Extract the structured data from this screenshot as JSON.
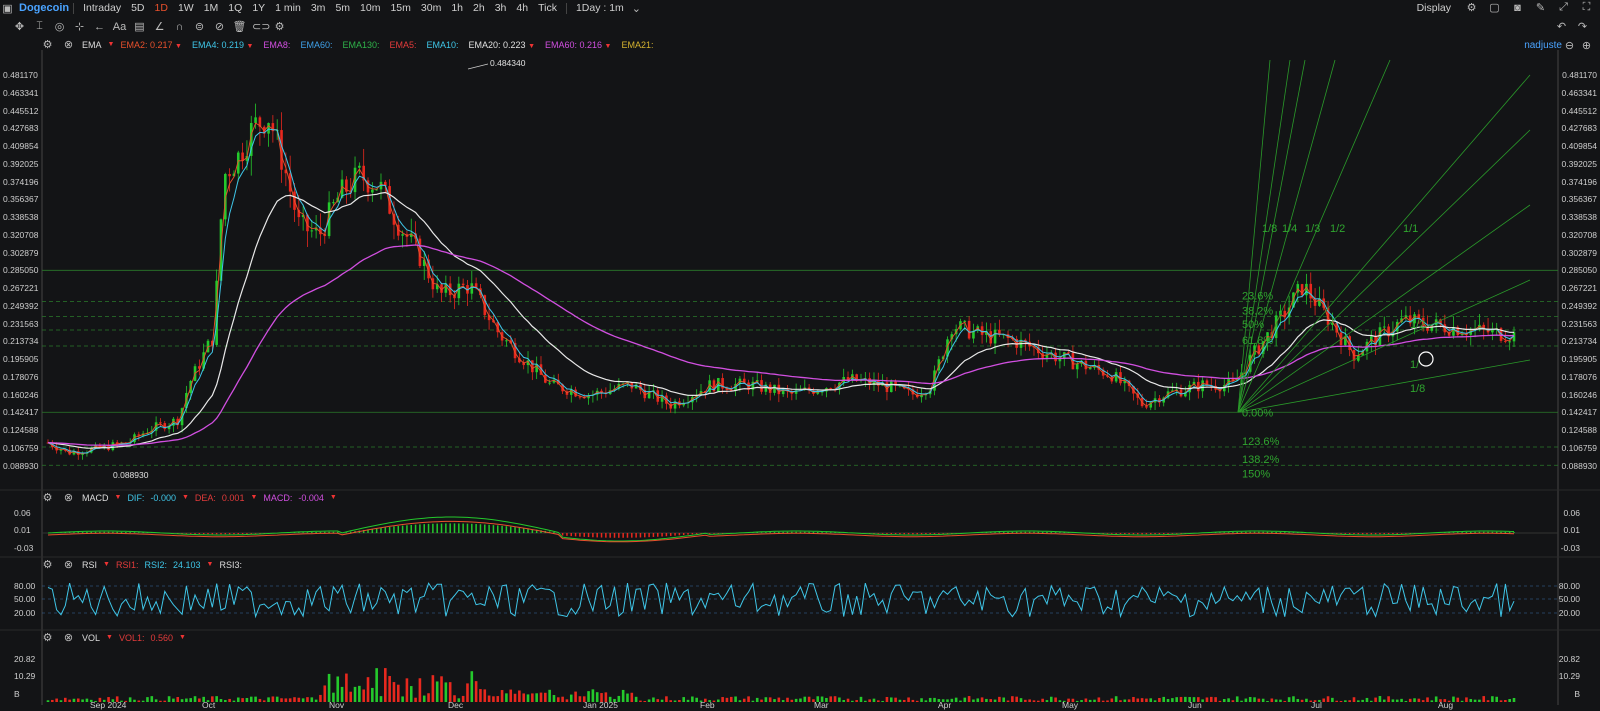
{
  "topbar": {
    "symbol": "Dogecoin",
    "timeframes": [
      "Intraday",
      "5D",
      "1D",
      "1W",
      "1M",
      "1Q",
      "1Y",
      "1 min",
      "3m",
      "5m",
      "10m",
      "15m",
      "30m",
      "1h",
      "2h",
      "3h",
      "4h",
      "Tick"
    ],
    "active_timeframe": "1D",
    "interval": "1Day : 1m",
    "display": "Display"
  },
  "toolbar": {
    "icons": [
      "move-icon",
      "cursor-icon",
      "circle-tool-icon",
      "measure-icon",
      "undo-arrow-icon",
      "text-icon",
      "comment-icon",
      "line-icon",
      "magnet-icon",
      "eye-icon",
      "hide-icon",
      "trash-icon",
      "link-icon",
      "settings-icon"
    ]
  },
  "ema": {
    "label": "EMA",
    "items": [
      {
        "name": "EMA2:",
        "value": "0.217",
        "color": "#e8502c"
      },
      {
        "name": "EMA4:",
        "value": "0.219",
        "color": "#3fc6e8"
      },
      {
        "name": "EMA8:",
        "value": "",
        "color": "#d14fe0"
      },
      {
        "name": "EMA60:",
        "value": "",
        "color": "#3fa0e8"
      },
      {
        "name": "EMA130:",
        "value": "",
        "color": "#2fb34a"
      },
      {
        "name": "EMA5:",
        "value": "",
        "color": "#e33b3b"
      },
      {
        "name": "EMA10:",
        "value": "",
        "color": "#3fc6e8"
      },
      {
        "name": "EMA20:",
        "value": "0.223",
        "color": "#e0e0e0"
      },
      {
        "name": "EMA60:",
        "value": "0.216",
        "color": "#d14fe0"
      },
      {
        "name": "EMA21:",
        "value": "",
        "color": "#d4b22f"
      }
    ],
    "adjust": "nadjuste"
  },
  "price_axis": [
    "0.481170",
    "0.463341",
    "0.445512",
    "0.427683",
    "0.409854",
    "0.392025",
    "0.374196",
    "0.356367",
    "0.338538",
    "0.320708",
    "0.302879",
    "0.285050",
    "0.267221",
    "0.249392",
    "0.231563",
    "0.213734",
    "0.195905",
    "0.178076",
    "0.160246",
    "0.142417",
    "0.124588",
    "0.106759",
    "0.088930"
  ],
  "annotations": {
    "high": "0.484340",
    "low": "0.088930"
  },
  "fib": {
    "levels": [
      "23.6%",
      "38.2%",
      "50%",
      "61.8%",
      "0.00%",
      "123.6%",
      "138.2%",
      "150%"
    ],
    "fan": [
      "1/8",
      "1/4",
      "1/3",
      "1/2",
      "1/1",
      "1/2",
      "1/",
      "1/8"
    ]
  },
  "macd": {
    "label": "MACD",
    "dif": "DIF:",
    "dif_val": "-0.000",
    "dea": "DEA:",
    "dea_val": "0.001",
    "macd": "MACD:",
    "macd_val": "-0.004",
    "axis": [
      "0.06",
      "0.01",
      "-0.03"
    ]
  },
  "rsi": {
    "label": "RSI",
    "rsi1": "RSI1:",
    "rsi2": "RSI2:",
    "rsi2_val": "24.103",
    "rsi3": "RSI3:",
    "axis": [
      "80.00",
      "50.00",
      "20.00"
    ]
  },
  "vol": {
    "label": "VOL",
    "vol1": "VOL1:",
    "vol1_val": "0.560",
    "axis": [
      "20.82",
      "10.29",
      "B"
    ]
  },
  "time_axis": [
    "Sep 2024",
    "Oct",
    "Nov",
    "Dec",
    "Jan 2025",
    "Feb",
    "Mar",
    "Apr",
    "May",
    "Jun",
    "Jul",
    "Aug"
  ]
}
